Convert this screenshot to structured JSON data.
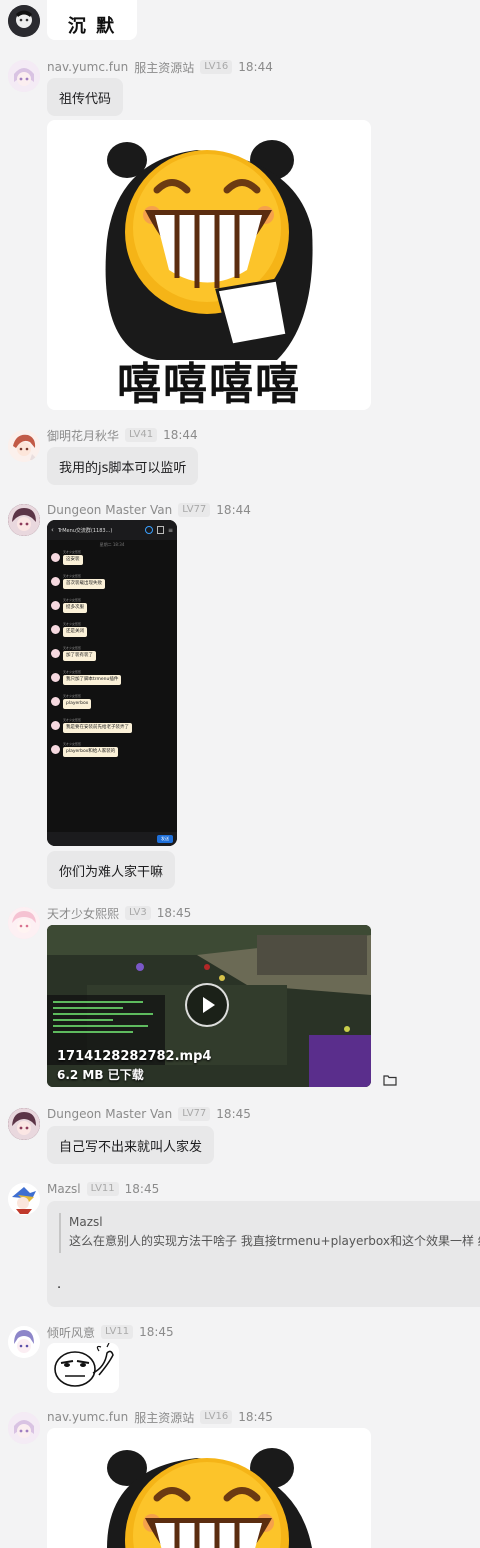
{
  "messages": [
    {
      "id": "m0",
      "sticker_text": "沉 默"
    },
    {
      "id": "m1",
      "name": "nav.yumc.fun",
      "tag": "服主资源站",
      "level": "LV16",
      "time": "18:44",
      "text": "祖传代码",
      "sticker_text": "嘻嘻嘻嘻"
    },
    {
      "id": "m2",
      "name": "御明花月秋华",
      "level": "LV41",
      "time": "18:44",
      "text": "我用的js脚本可以监听"
    },
    {
      "id": "m3",
      "name": "Dungeon Master Van",
      "level": "LV77",
      "time": "18:44",
      "text": "你们为难人家干嘛"
    },
    {
      "id": "m4",
      "name": "天才少女熙熙",
      "level": "LV3",
      "time": "18:45",
      "video": {
        "filename": "1714128282782.mp4",
        "size": "6.2 MB",
        "status": "已下载"
      }
    },
    {
      "id": "m5",
      "name": "Dungeon Master Van",
      "level": "LV77",
      "time": "18:45",
      "text": "自己写不出来就叫人家发"
    },
    {
      "id": "m6",
      "name": "Mazsl",
      "level": "LV11",
      "time": "18:45",
      "quote_author": "Mazsl",
      "quote_text": "这么在意别人的实现方法干啥子 我直接trmenu+playerbox和这个效果一样 结",
      "reply": "."
    },
    {
      "id": "m7",
      "name": "倾听风意",
      "level": "LV11",
      "time": "18:45"
    },
    {
      "id": "m8",
      "name": "nav.yumc.fun",
      "tag": "服主资源站",
      "level": "LV16",
      "time": "18:45"
    }
  ],
  "phone_screenshot": {
    "title": "TrMenu交流群(1183...)",
    "subtitle": "星期二 18:34",
    "sender": "天才少女熙熙",
    "lines": [
      "这安装",
      "首次装载出现失败",
      "挺多次服",
      "还是关闭",
      "加了装有装了",
      "我只加了脚本trmenu插件",
      "playerbox",
      "我是要在安装前先给老子装弄了",
      "playerbox和给人家装的"
    ],
    "send": "发送"
  },
  "colors": {
    "bubble": "#e8e8e9",
    "background": "#f3f3f4",
    "meta": "#8b8b8b",
    "emoji_yellow": "#f5b417"
  }
}
